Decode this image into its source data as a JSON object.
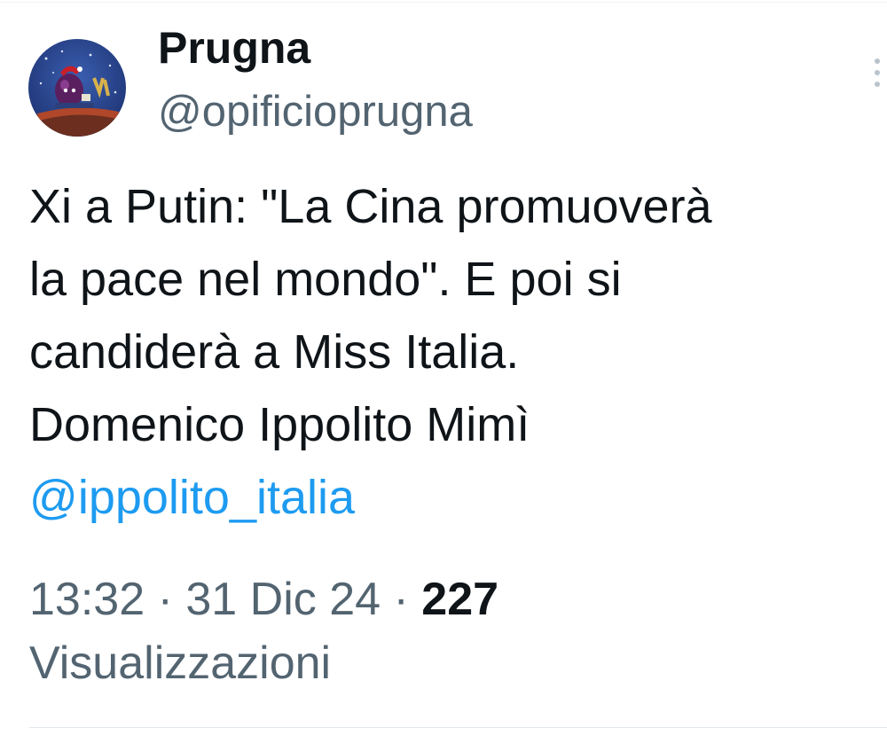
{
  "author": {
    "display_name": "Prugna",
    "handle": "@opificioprugna"
  },
  "tweet": {
    "lines": [
      "Xi a Putin: \"La Cina promuoverà",
      "la pace nel mondo\". E poi si",
      "candiderà a Miss Italia.",
      "Domenico Ippolito Mimì"
    ],
    "mention": "@ippolito_italia"
  },
  "meta": {
    "time": "13:32",
    "separator": "·",
    "date": "31 Dic 24",
    "views_count": "227",
    "views_label": "Visualizzazioni"
  },
  "colors": {
    "link": "#1d9bf0",
    "secondary_text": "#536471",
    "primary_text": "#0f1419"
  },
  "icons": {
    "more": "more-vertical-icon",
    "avatar": "avatar-image"
  }
}
